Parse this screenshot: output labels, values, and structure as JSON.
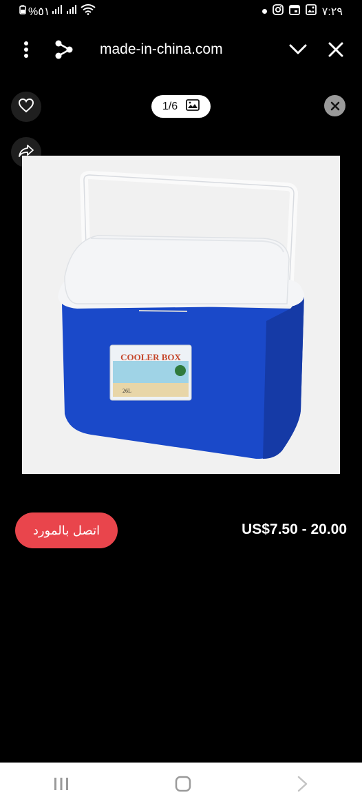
{
  "status": {
    "battery_text": "%٥١",
    "time": "٧:٢٩"
  },
  "browser": {
    "url": "made-in-china.com"
  },
  "gallery": {
    "counter": "1/6"
  },
  "product": {
    "label_text": "COOLER BOX",
    "capacity_text": "26L",
    "price": "US$7.50 - 20.00",
    "contact_label": "اتصل بالمورد"
  },
  "colors": {
    "accent": "#e9454c",
    "cooler_blue": "#1a49c9",
    "lid_white": "#f4f5f7"
  },
  "icons": [
    "menu-dots-icon",
    "share-icon",
    "chevron-down-icon",
    "close-icon",
    "heart-icon",
    "gallery-icon",
    "forward-share-icon",
    "nav-recents-icon",
    "nav-home-icon",
    "nav-back-icon"
  ]
}
